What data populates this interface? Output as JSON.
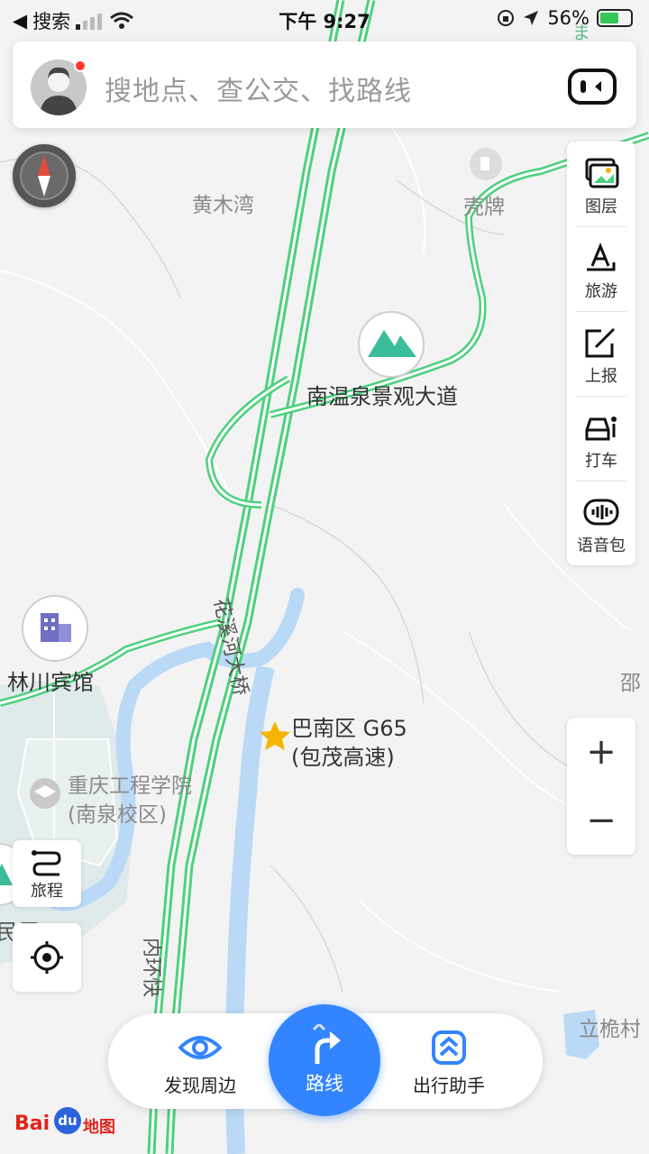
{
  "status_bar": {
    "back_label": "搜索",
    "time": "下午 9:27",
    "battery_percent": "56%",
    "battery_level": 0.56
  },
  "search": {
    "placeholder": "搜地点、查公交、找路线"
  },
  "right_tools": [
    {
      "label": "图层",
      "icon": "layers-icon"
    },
    {
      "label": "旅游",
      "icon": "travel-icon"
    },
    {
      "label": "上报",
      "icon": "report-icon"
    },
    {
      "label": "打车",
      "icon": "taxi-icon"
    },
    {
      "label": "语音包",
      "icon": "voice-pack-icon"
    }
  ],
  "zoom": {
    "in": "+",
    "out": "−"
  },
  "left_tools": {
    "trip_label": "旅程"
  },
  "bottom_bar": {
    "discover_label": "发现周边",
    "route_label": "路线",
    "assistant_label": "出行助手"
  },
  "map": {
    "labels": {
      "huangmuwan": "黄木湾",
      "kepai": "壳牌",
      "scenic_avenue": "南温泉景观大道",
      "linchuan_hotel": "林川宾馆",
      "shao": "邵",
      "poi_marker_line1": "巴南区 G65",
      "poi_marker_line2": "(包茂高速)",
      "college_line1": "重庆工程学院",
      "college_line2": "(南泉校区)",
      "minju": "民居",
      "lichuancun": "立桅村",
      "bridge": "花溪河大桥",
      "inner_ring": "内环快",
      "road_top": "ま"
    }
  },
  "logo": {
    "text_bai": "Bai",
    "text_du": "du",
    "text_map": "地图"
  },
  "colors": {
    "accent": "#3385ff",
    "road_green": "#4cd07d",
    "water": "#b9d9f7",
    "marker": "#f5b400",
    "notification": "#ff3b30"
  }
}
